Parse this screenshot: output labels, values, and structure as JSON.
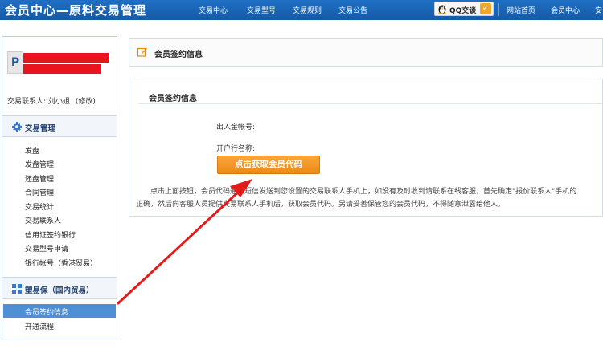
{
  "header": {
    "title": "会员中心—原料交易管理",
    "nav": [
      "交易中心",
      "交易型号",
      "交易规则",
      "交易公告"
    ],
    "qq_label": "QQ交谈",
    "right_links": [
      "网站首页",
      "会员中心",
      "安"
    ]
  },
  "sidebar": {
    "contact_label": "交易联系人:",
    "contact_name": "刘小姐",
    "contact_edit": "(修改)",
    "section1": "交易管理",
    "items1": [
      "发盘",
      "发盘管理",
      "还盘管理",
      "合同管理",
      "交易统计",
      "交易联系人",
      "信用证签约银行",
      "交易型号申请",
      "银行帐号（香港贸易）"
    ],
    "section2": "塑易保（国内贸易）",
    "items2": [
      "会员签约信息",
      "开通流程"
    ]
  },
  "main": {
    "page_title": "会员签约信息",
    "card_title": "会员签约信息",
    "field_account": "出入金帐号:",
    "field_bank": "开户行名称:",
    "get_code_button": "点击获取会员代码",
    "note_line1": "点击上面按钮，会员代码通过短信发送到您设置的交易联系人手机上，如没有及时收到请联系在线客服，首先确定\"报价联系人\"手机的",
    "note_line2": "正确，然后向客服人员提供交易联系人手机后，获取会员代码。另请妥善保管您的会员代码，不得随意泄露给他人。"
  },
  "colors": {
    "header_blue": "#1a64b8",
    "accent_orange": "#ef8e1a",
    "active_menu": "#4f8fd6",
    "annotation_arrow": "#e41b1b"
  },
  "icons": {
    "qq": "penguin-icon",
    "qq_check": "checkmark-icon",
    "section1": "gear-icon",
    "section2": "grid-icon",
    "page_title": "edit-icon"
  }
}
